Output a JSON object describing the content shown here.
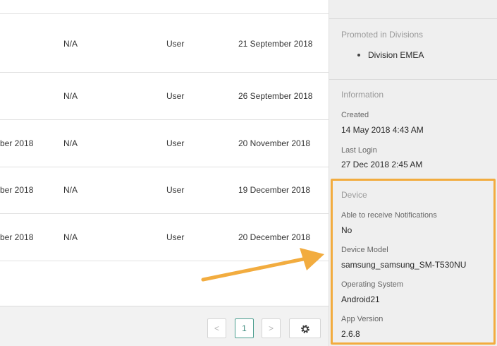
{
  "table": {
    "rows": [
      {
        "date1": "",
        "status": "N/A",
        "role": "User",
        "date2": "21 September 2018"
      },
      {
        "date1": "",
        "status": "N/A",
        "role": "User",
        "date2": "26 September 2018"
      },
      {
        "date1": "ber 2018",
        "status": "N/A",
        "role": "User",
        "date2": "20 November 2018"
      },
      {
        "date1": "ber 2018",
        "status": "N/A",
        "role": "User",
        "date2": "19 December 2018"
      },
      {
        "date1": "ber 2018",
        "status": "N/A",
        "role": "User",
        "date2": "20 December 2018"
      }
    ]
  },
  "pagination": {
    "prev_label": "<",
    "current_page": "1",
    "next_label": ">",
    "settings_icon": "gear-icon"
  },
  "panel": {
    "promoted": {
      "heading": "Promoted in Divisions",
      "items": [
        "Division EMEA"
      ]
    },
    "information": {
      "heading": "Information",
      "created_label": "Created",
      "created_value": "14 May 2018 4:43 AM",
      "last_login_label": "Last Login",
      "last_login_value": "27 Dec 2018 2:45 AM"
    },
    "device": {
      "heading": "Device",
      "notifications_label": "Able to receive Notifications",
      "notifications_value": "No",
      "model_label": "Device Model",
      "model_value": "samsung_samsung_SM-T530NU",
      "os_label": "Operating System",
      "os_value": "Android21",
      "app_version_label": "App Version",
      "app_version_value": "2.6.8"
    }
  },
  "annotation": {
    "highlight_color": "#f2ac3f",
    "arrow_color": "#f2ac3f"
  }
}
